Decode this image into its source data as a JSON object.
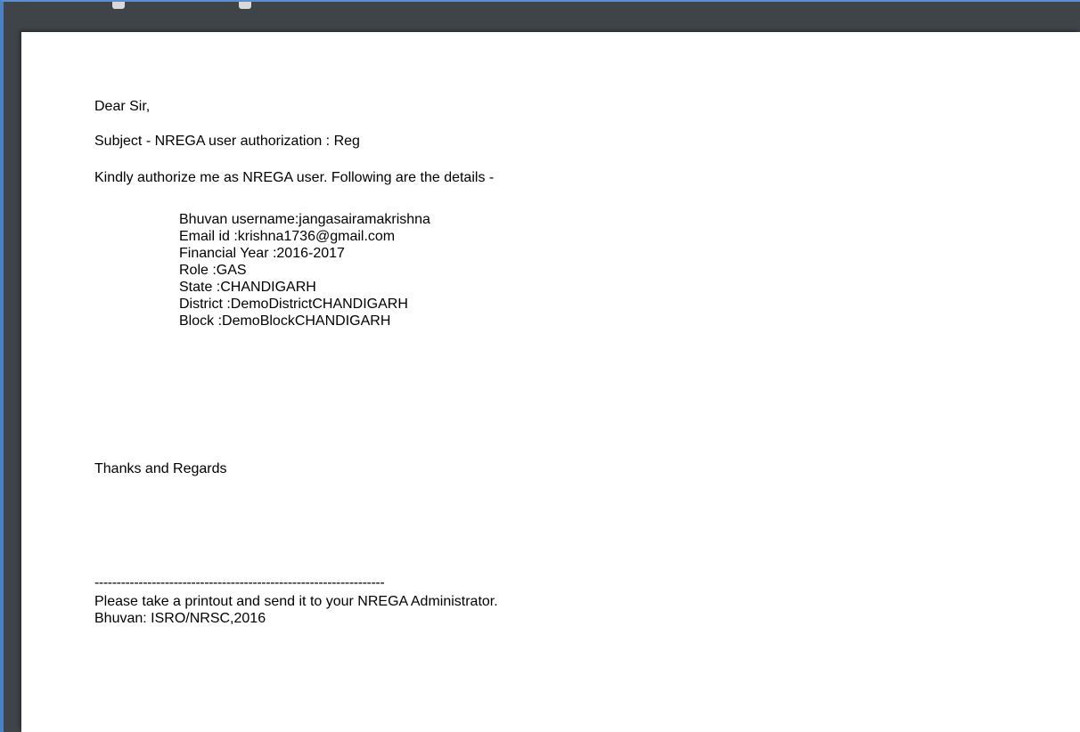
{
  "letter": {
    "salutation": "Dear Sir,",
    "subject": "Subject - NREGA user authorization : Reg",
    "intro": "Kindly authorize me as NREGA user. Following are the details -",
    "details": [
      "Bhuvan username:jangasairamakrishna",
      "Email id :krishna1736@gmail.com",
      "Financial Year :2016-2017",
      "Role :GAS",
      "State :CHANDIGARH",
      "District :DemoDistrictCHANDIGARH",
      "Block :DemoBlockCHANDIGARH"
    ],
    "closing": "Thanks and Regards",
    "separator": "------------------------------------------------------------------",
    "footer_note": "Please take a printout and send it to your NREGA Administrator.",
    "copyright": "Bhuvan: ISRO/NRSC,2016"
  }
}
